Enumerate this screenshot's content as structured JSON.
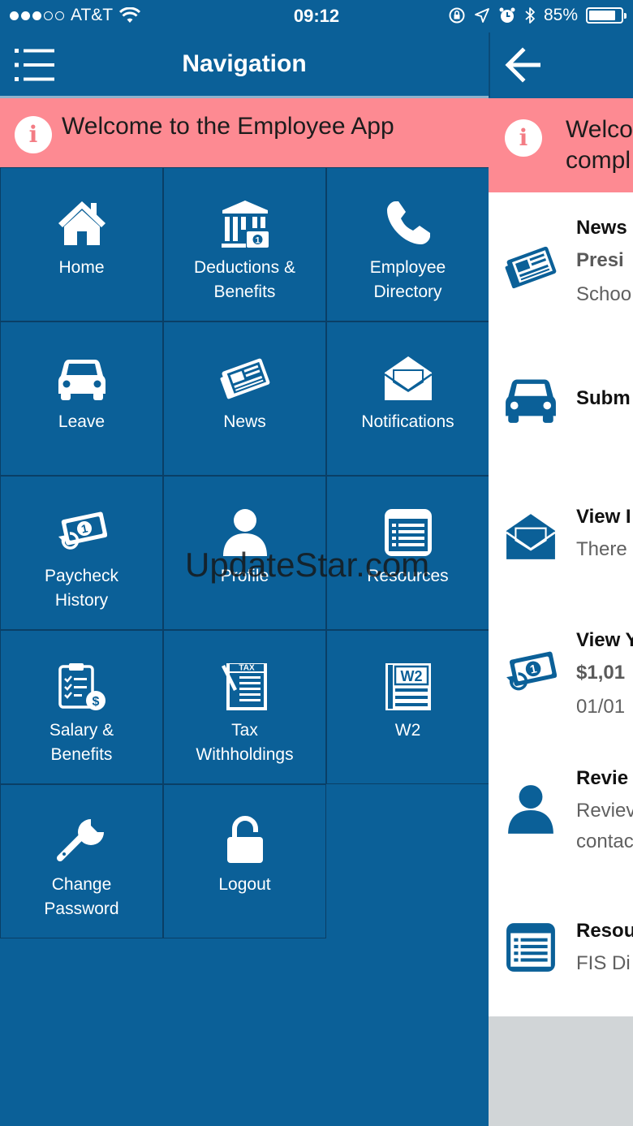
{
  "status_bar": {
    "carrier": "AT&T",
    "time": "09:12",
    "battery_percent_label": "85%",
    "battery_level": 0.85,
    "icons": [
      "signal-dots",
      "wifi-icon",
      "screen-lock-icon",
      "location-arrow-icon",
      "alarm-icon",
      "bluetooth-icon",
      "battery-icon"
    ]
  },
  "header": {
    "title": "Navigation",
    "menu_icon": "list-menu-icon",
    "back_icon": "arrow-left-icon"
  },
  "banner": {
    "text": "Welcome to the Employee App",
    "icon": "info-icon"
  },
  "tiles": [
    {
      "label": "Home",
      "icon": "home-icon"
    },
    {
      "label": "Deductions &\nBenefits",
      "icon": "bank-icon"
    },
    {
      "label": "Employee\nDirectory",
      "icon": "phone-icon"
    },
    {
      "label": "Leave",
      "icon": "car-icon"
    },
    {
      "label": "News",
      "icon": "newspaper-icon"
    },
    {
      "label": "Notifications",
      "icon": "envelope-icon"
    },
    {
      "label": "Paycheck\nHistory",
      "icon": "money-history-icon"
    },
    {
      "label": "Profile",
      "icon": "user-icon"
    },
    {
      "label": "Resources",
      "icon": "list-box-icon"
    },
    {
      "label": "Salary &\nBenefits",
      "icon": "clipboard-dollar-icon"
    },
    {
      "label": "Tax\nWithholdings",
      "icon": "tax-form-icon"
    },
    {
      "label": "W2",
      "icon": "w2-form-icon"
    },
    {
      "label": "Change\nPassword",
      "icon": "wrench-icon"
    },
    {
      "label": "Logout",
      "icon": "unlock-icon"
    }
  ],
  "watermark": "UpdateStar.com",
  "panel": {
    "banner_text": "Welco\ncompl",
    "items": [
      {
        "icon": "newspaper-icon",
        "title": "News",
        "lines": [
          "Presi",
          "Schoo"
        ]
      },
      {
        "icon": "car-icon",
        "title": "Subm",
        "lines": []
      },
      {
        "icon": "envelope-icon",
        "title": "View I",
        "lines": [
          "There"
        ]
      },
      {
        "icon": "money-history-icon",
        "title": "View Y",
        "lines": [
          "$1,01",
          "01/01"
        ]
      },
      {
        "icon": "user-icon",
        "title": "Revie",
        "lines": [
          "Reviev",
          "contac"
        ]
      },
      {
        "icon": "list-box-icon",
        "title": "Resou",
        "lines": [
          "FIS Di"
        ]
      }
    ]
  },
  "colors": {
    "primary": "#0b6098",
    "banner": "#fd8a92",
    "grid_border": "#0a3f66",
    "panel_bg": "#ffffff",
    "panel_icon": "#0b6098"
  }
}
